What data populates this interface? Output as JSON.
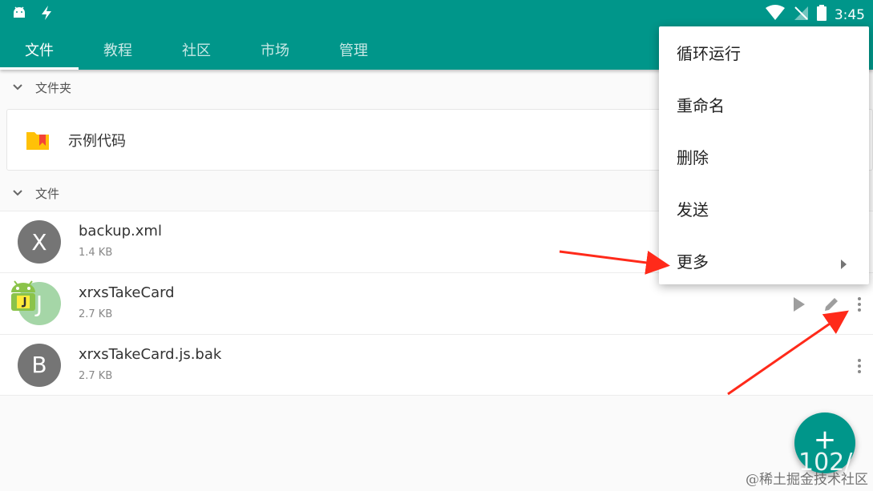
{
  "status": {
    "time": "3:45",
    "left_icons": [
      "android-icon",
      "flash-icon"
    ],
    "right_icons": [
      "wifi-icon",
      "signal-off-icon",
      "battery-icon"
    ]
  },
  "tabs": [
    {
      "label": "文件",
      "active": true
    },
    {
      "label": "教程",
      "active": false
    },
    {
      "label": "社区",
      "active": false
    },
    {
      "label": "市场",
      "active": false
    },
    {
      "label": "管理",
      "active": false
    }
  ],
  "sections": {
    "folders_label": "文件夹",
    "files_label": "文件"
  },
  "folders": [
    {
      "name": "示例代码",
      "icon": "folder-icon"
    }
  ],
  "files": [
    {
      "name": "backup.xml",
      "size": "1.4 KB",
      "avatar_letter": "X",
      "avatar_color": "#757575"
    },
    {
      "name": "xrxsTakeCard",
      "size": "2.7 KB",
      "avatar_letter": "J",
      "avatar_color": "#a5d6a7"
    },
    {
      "name": "xrxsTakeCard.js.bak",
      "size": "2.7 KB",
      "avatar_letter": "B",
      "avatar_color": "#757575"
    }
  ],
  "menu": {
    "items": [
      {
        "label": "循环运行"
      },
      {
        "label": "重命名"
      },
      {
        "label": "删除"
      },
      {
        "label": "发送"
      },
      {
        "label": "更多",
        "has_submenu": true
      }
    ]
  },
  "fab": {
    "label": "+",
    "overlay_text": "102/"
  },
  "watermark": "@稀土掘金技术社区",
  "colors": {
    "primary": "#00968a",
    "annotation_arrow": "#ff2a1a"
  }
}
